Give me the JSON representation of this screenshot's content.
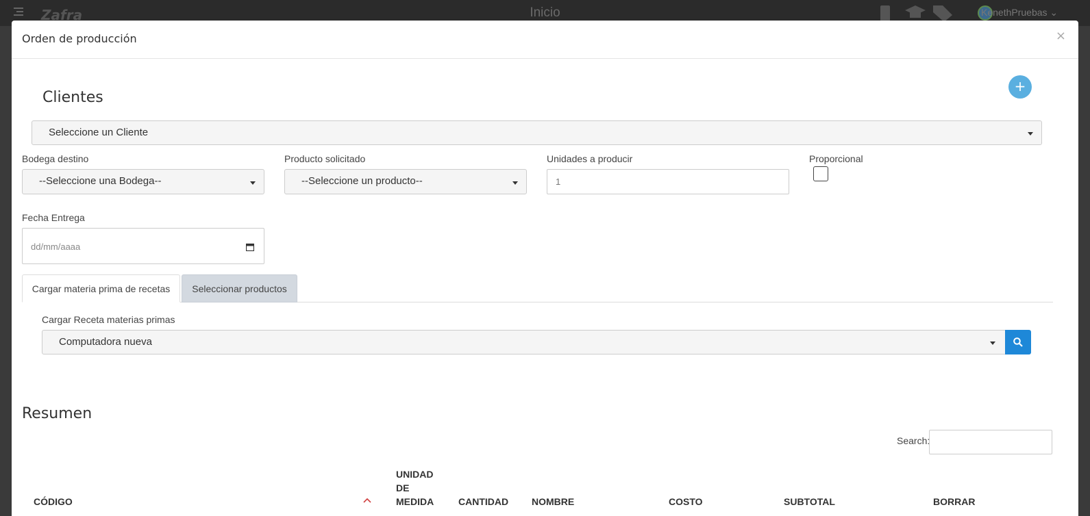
{
  "app": {
    "logo": "Zafra",
    "page_title": "Inicio",
    "user_name": "KenethPruebas"
  },
  "modal": {
    "title": "Orden de producción",
    "close": "×"
  },
  "clientes": {
    "heading": "Clientes",
    "add_button": "+",
    "select_value": "Seleccione un Cliente"
  },
  "form": {
    "bodega_label": "Bodega destino",
    "bodega_value": "--Seleccione una Bodega--",
    "producto_label": "Producto solicitado",
    "producto_value": "--Seleccione un producto--",
    "unidades_label": "Unidades a producir",
    "unidades_placeholder": "1",
    "proporcional_label": "Proporcional",
    "fecha_label": "Fecha Entrega",
    "fecha_placeholder": "dd/mm/aaaa"
  },
  "tabs": [
    {
      "label": "Cargar materia prima de recetas",
      "active": true
    },
    {
      "label": "Seleccionar productos",
      "active": false
    }
  ],
  "receta": {
    "label": "Cargar Receta materias primas",
    "value": "Computadora nueva"
  },
  "resumen": {
    "heading": "Resumen",
    "search_label": "Search:",
    "columns": [
      "CÓDIGO",
      "UNIDAD DE MEDIDA",
      "CANTIDAD",
      "NOMBRE",
      "COSTO",
      "SUBTOTAL",
      "BORRAR"
    ]
  },
  "colors": {
    "primary": "#1e88d8",
    "add_button": "#5aafe0",
    "sort_icon": "#d04040"
  }
}
